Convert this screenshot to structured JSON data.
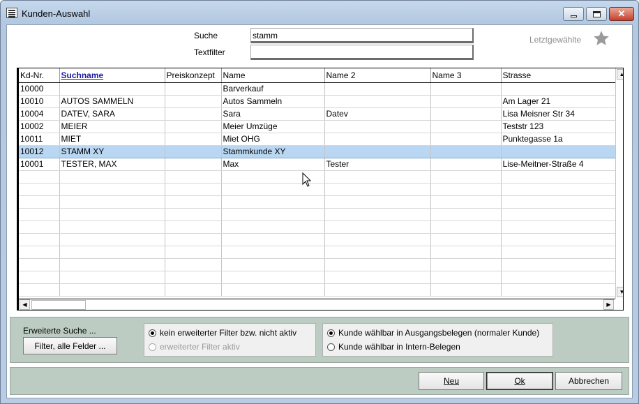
{
  "window": {
    "title": "Kunden-Auswahl"
  },
  "search": {
    "label": "Suche",
    "value": "stamm",
    "filter_label": "Textfilter",
    "filter_value": ""
  },
  "recent": {
    "label": "Letztgewählte"
  },
  "table": {
    "columns": [
      "Kd-Nr.",
      "Suchname",
      "Preiskonzept",
      "Name",
      "Name 2",
      "Name 3",
      "Strasse"
    ],
    "rows": [
      [
        "10000",
        "",
        "",
        "Barverkauf",
        "",
        "",
        ""
      ],
      [
        "10010",
        "AUTOS SAMMELN",
        "",
        "Autos Sammeln",
        "",
        "",
        "Am Lager 21"
      ],
      [
        "10004",
        "DATEV, SARA",
        "",
        "Sara",
        "Datev",
        "",
        "Lisa Meisner Str 34"
      ],
      [
        "10002",
        "MEIER",
        "",
        "Meier Umzüge",
        "",
        "",
        "Teststr 123"
      ],
      [
        "10011",
        "MIET",
        "",
        "Miet OHG",
        "",
        "",
        "Punktegasse 1a"
      ],
      [
        "10012",
        "STAMM XY",
        "",
        "Stammkunde XY",
        "",
        "",
        ""
      ],
      [
        "10001",
        "TESTER, MAX",
        "",
        "Max",
        "Tester",
        "",
        "Lise-Meitner-Straße 4"
      ]
    ],
    "selected_row": 5
  },
  "extended": {
    "label": "Erweiterte Suche ...",
    "button": "Filter, alle Felder ...",
    "filter_options": [
      "kein erweiterter Filter bzw. nicht aktiv",
      "erweiterter Filter aktiv"
    ],
    "customer_options": [
      "Kunde wählbar in Ausgangsbelegen (normaler Kunde)",
      "Kunde wählbar in Intern-Belegen"
    ]
  },
  "buttons": {
    "new": "Neu",
    "ok": "Ok",
    "cancel": "Abbrechen"
  }
}
